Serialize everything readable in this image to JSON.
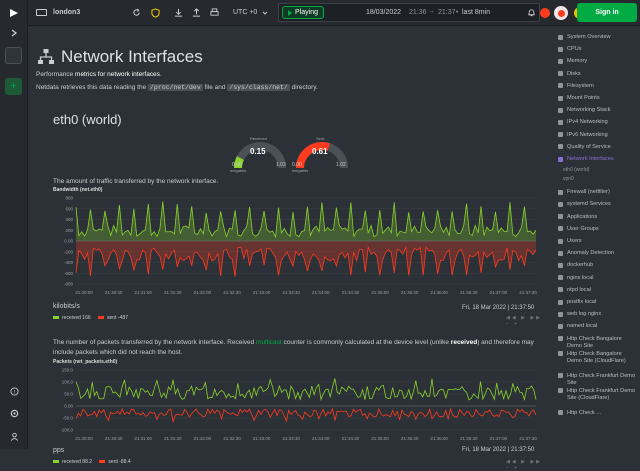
{
  "topbar": {
    "space_name": "london3",
    "timezone": "UTC +0",
    "playing_label": "Playing",
    "date": "18/03/2022",
    "time_start": "21:36",
    "time_end": "21:37",
    "duration": "last 8min",
    "signin_label": "Sign in",
    "alert_count": ""
  },
  "page": {
    "title": "Network Interfaces",
    "desc_pre": "Performance ",
    "desc_bold": "metrics for network interfaces",
    "desc_post": ".",
    "netdata_pre": "Netdata retrieves this data reading the ",
    "code1": "/proc/net/dev",
    "netdata_mid": " file and ",
    "code2": "/sys/class/net/",
    "netdata_post": " directory.",
    "section": "eth0 (world)"
  },
  "gauges": [
    {
      "label": "Received",
      "value": "0.15",
      "min": "0.00",
      "max": "1.03",
      "unit": "megabits",
      "color": "#8ad22c",
      "fraction": 0.15
    },
    {
      "label": "Sent",
      "value": "0.61",
      "min": "0.00",
      "max": "1.02",
      "unit": "megabits",
      "color": "#ff3b1f",
      "fraction": 0.6
    }
  ],
  "charts": [
    {
      "desc": "The amount of traffic transferred by the network interface.",
      "title": "Bandwidth (net.eth0)",
      "unit": "kilobits/s",
      "timestamp": "Fri, 18 Mar 2022 | 21:37:50",
      "legend": [
        {
          "name": "received",
          "value": "166",
          "color": "#8ad22c"
        },
        {
          "name": "sent",
          "value": "-487",
          "color": "#ff3b1f"
        }
      ],
      "yticks": [
        "800",
        "600",
        "400",
        "200",
        "0.00",
        "-200",
        "-400",
        "-600",
        "-800"
      ],
      "xticks": [
        "21:30:00",
        "21:30:30",
        "21:31:00",
        "21:31:30",
        "21:32:00",
        "21:32:30",
        "21:33:00",
        "21:33:30",
        "21:34:00",
        "21:34:30",
        "21:35:00",
        "21:35:30",
        "21:36:00",
        "21:36:30",
        "21:37:00",
        "21:37:30"
      ]
    },
    {
      "desc_pre": "The number of packets transferred by the network interface. Received ",
      "desc_link": "multicast",
      "desc_mid": " counter is commonly calculated at the device level (unlike ",
      "desc_bold": "received",
      "desc_post": ") and therefore may include packets which did not reach the host.",
      "title": "Packets (net_packets.eth0)",
      "unit": "pps",
      "timestamp": "Fri, 18 Mar 2022 | 21:37:50",
      "legend": [
        {
          "name": "received",
          "value": "88.2",
          "color": "#8ad22c"
        },
        {
          "name": "sent",
          "value": "-88.4",
          "color": "#ff3b1f"
        }
      ],
      "yticks": [
        "150.0",
        "100.0",
        "50.0",
        "0.00",
        "-50.0",
        "-100.0"
      ],
      "xticks": [
        "21:30:00",
        "21:30:30",
        "21:31:00",
        "21:31:30",
        "21:32:00",
        "21:32:30",
        "21:33:00",
        "21:33:30",
        "21:34:00",
        "21:34:30",
        "21:35:00",
        "21:35:30",
        "21:36:00",
        "21:36:30",
        "21:37:00",
        "21:37:30"
      ]
    }
  ],
  "sidebar": {
    "items": [
      {
        "label": "System Overview",
        "active": false
      },
      {
        "label": "CPUs",
        "active": false
      },
      {
        "label": "Memory",
        "active": false
      },
      {
        "label": "Disks",
        "active": false
      },
      {
        "label": "Filesystem",
        "active": false
      },
      {
        "label": "Mount Points",
        "active": false
      },
      {
        "label": "Networking Stack",
        "active": false
      },
      {
        "label": "IPv4 Networking",
        "active": false
      },
      {
        "label": "IPv6 Networking",
        "active": false
      },
      {
        "label": "Quality of Service",
        "active": false
      },
      {
        "label": "Network Interfaces",
        "active": true
      },
      {
        "label": "Firewall (netfilter)",
        "active": false
      },
      {
        "label": "systemd Services",
        "active": false
      },
      {
        "label": "Applications",
        "active": false
      },
      {
        "label": "User Groups",
        "active": false
      },
      {
        "label": "Users",
        "active": false
      },
      {
        "label": "Anomaly Detection",
        "active": false
      },
      {
        "label": "dockerhub",
        "active": false
      },
      {
        "label": "nginx local",
        "active": false
      },
      {
        "label": "ntpd local",
        "active": false
      },
      {
        "label": "postfix local",
        "active": false
      },
      {
        "label": "web log nginx",
        "active": false
      },
      {
        "label": "named local",
        "active": false
      }
    ],
    "subitems": [
      "eth0 (world)",
      "vpn0"
    ],
    "http_items": [
      "Http Check Bangalore Demo Site",
      "Http Check Bangalore Demo Site (CloudFlare)",
      "Http Check Frankfurt Demo Site",
      "Http Check Frankfurt Demo Site (CloudFlare)",
      "Http Check ..."
    ]
  },
  "colors": {
    "accent": "#00ab44",
    "received": "#8ad22c",
    "sent": "#ff3b1f",
    "active": "#8b6fd6"
  }
}
